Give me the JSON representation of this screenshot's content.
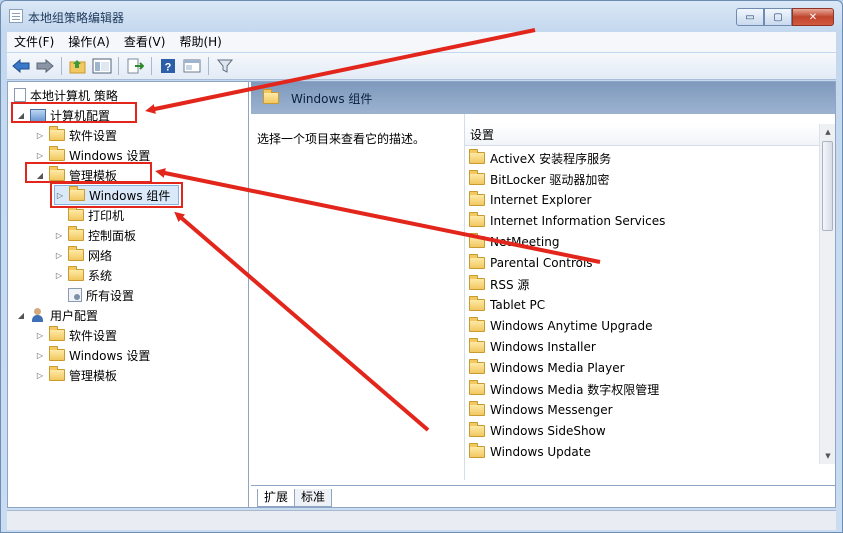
{
  "window": {
    "title": "本地组策略编辑器",
    "caption_buttons": {
      "minimize": "▭",
      "maximize": "▢",
      "close": "✕"
    }
  },
  "menu": [
    "文件(F)",
    "操作(A)",
    "查看(V)",
    "帮助(H)"
  ],
  "toolbar": {
    "icons": [
      "back-arrow-icon",
      "forward-arrow-icon",
      "up-folder-icon",
      "show-tree-icon",
      "export-icon",
      "help-icon",
      "properties-icon",
      "filter-icon"
    ]
  },
  "tree": {
    "root": "本地计算机 策略",
    "items": [
      {
        "label": "计算机配置",
        "icon": "computer-icon",
        "arrow": "◢"
      },
      {
        "label": "软件设置",
        "icon": "folder-icon",
        "arrow": "▷"
      },
      {
        "label": "Windows 设置",
        "icon": "folder-icon",
        "arrow": "▷"
      },
      {
        "label": "管理模板",
        "icon": "folder-icon",
        "arrow": "◢"
      },
      {
        "label": "Windows 组件",
        "icon": "folder-icon",
        "arrow": "▷"
      },
      {
        "label": "打印机",
        "icon": "folder-icon",
        "arrow": ""
      },
      {
        "label": "控制面板",
        "icon": "folder-icon",
        "arrow": "▷"
      },
      {
        "label": "网络",
        "icon": "folder-icon",
        "arrow": "▷"
      },
      {
        "label": "系统",
        "icon": "folder-icon",
        "arrow": "▷"
      },
      {
        "label": "所有设置",
        "icon": "settings-icon",
        "arrow": ""
      },
      {
        "label": "用户配置",
        "icon": "user-icon",
        "arrow": "◢"
      },
      {
        "label": "软件设置",
        "icon": "folder-icon",
        "arrow": "▷"
      },
      {
        "label": "Windows 设置",
        "icon": "folder-icon",
        "arrow": "▷"
      },
      {
        "label": "管理模板",
        "icon": "folder-icon",
        "arrow": "▷"
      }
    ]
  },
  "right_pane": {
    "header_title": "Windows 组件",
    "description": "选择一个项目来查看它的描述。",
    "list_header": "设置",
    "items": [
      "ActiveX 安装程序服务",
      "BitLocker 驱动器加密",
      "Internet Explorer",
      "Internet Information Services",
      "NetMeeting",
      "Parental Controls",
      "RSS 源",
      "Tablet PC",
      "Windows Anytime Upgrade",
      "Windows Installer",
      "Windows Media Player",
      "Windows Media 数字权限管理",
      "Windows Messenger",
      "Windows SideShow",
      "Windows Update"
    ],
    "tabs": [
      "扩展",
      "标准"
    ]
  },
  "colors": {
    "annotation": "#e2261c",
    "header_band": "#8ea8c9",
    "selection": "#d9e9f9"
  }
}
